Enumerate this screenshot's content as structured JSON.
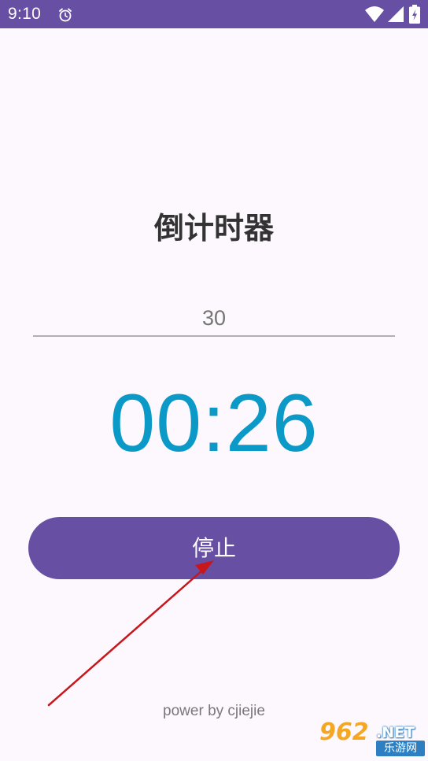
{
  "status_bar": {
    "time": "9:10",
    "icons": [
      "alarm-icon",
      "wifi-icon",
      "signal-icon",
      "battery-charging-icon"
    ],
    "background_color": "#6750a4"
  },
  "main": {
    "title": "倒计时器",
    "input": {
      "value": "",
      "placeholder": "30"
    },
    "countdown": "00:26",
    "countdown_color": "#0b9ac8",
    "stop_button_label": "停止",
    "accent_color": "#6750a4"
  },
  "footer": {
    "text": "power by cjiejie"
  },
  "watermark": {
    "number": "962",
    "domain": ".NET",
    "site_name": "乐游网"
  }
}
